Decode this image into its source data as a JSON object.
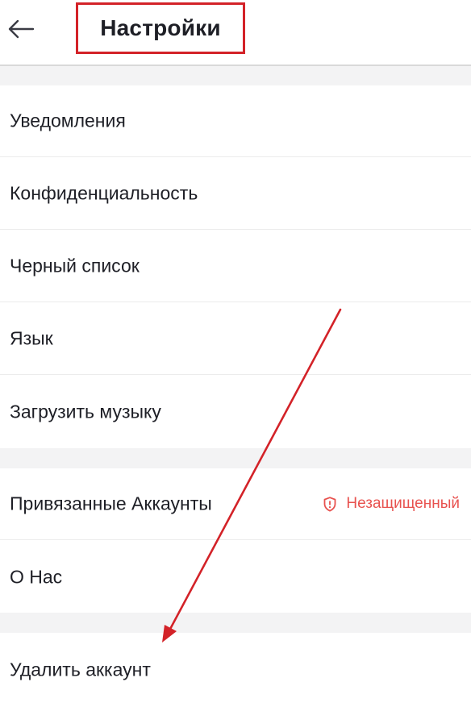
{
  "header": {
    "back_icon": "arrow-left-icon",
    "title": "Настройки"
  },
  "sections": [
    {
      "items": [
        {
          "label": "Уведомления"
        },
        {
          "label": "Конфиденциальность"
        },
        {
          "label": "Черный список"
        },
        {
          "label": "Язык"
        },
        {
          "label": "Загрузить музыку"
        }
      ]
    },
    {
      "items": [
        {
          "label": "Привязанные Аккаунты",
          "badge": "Незащищенный",
          "badge_icon": "shield-alert-icon"
        },
        {
          "label": "О Нас"
        }
      ]
    },
    {
      "items": [
        {
          "label": "Удалить аккаунт"
        }
      ]
    }
  ],
  "colors": {
    "annotation_red": "#d32228",
    "warning_red": "#e8524f",
    "separator_gray": "#f3f3f4"
  }
}
